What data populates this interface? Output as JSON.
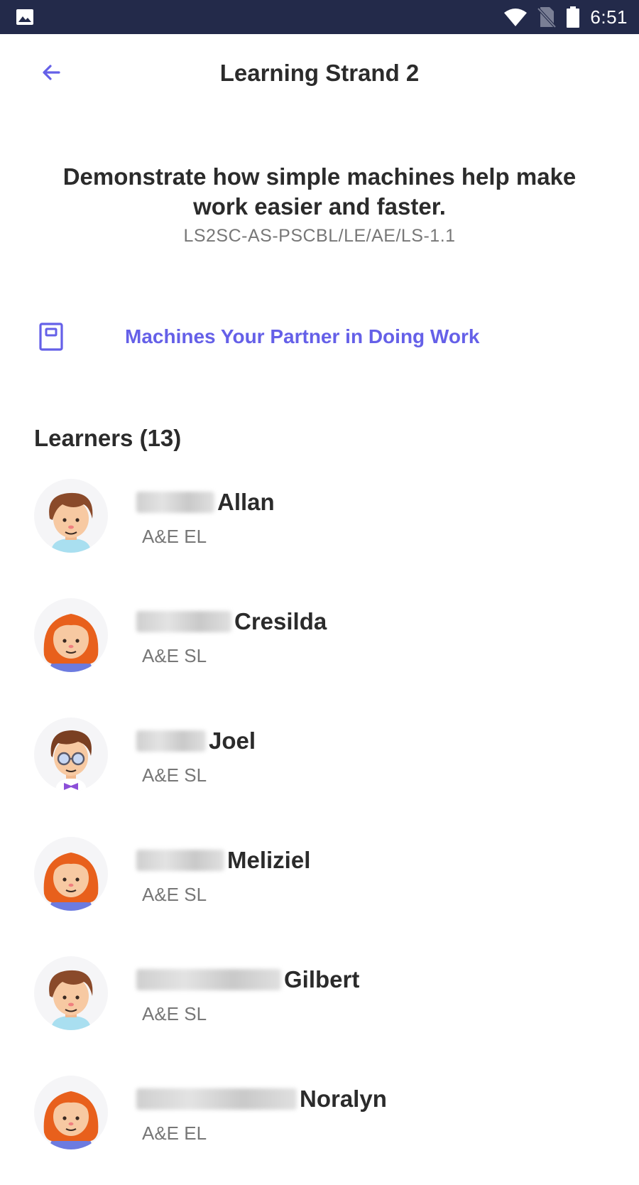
{
  "status_bar": {
    "time": "6:51",
    "icons": [
      "image-icon",
      "wifi-icon",
      "no-sim-icon",
      "battery-icon"
    ]
  },
  "header": {
    "back_icon": "arrow-left-icon",
    "title": "Learning Strand 2"
  },
  "objective": {
    "text": "Demonstrate how simple machines help make work easier and faster.",
    "code": "LS2SC-AS-PSCBL/LE/AE/LS-1.1"
  },
  "module": {
    "icon": "book-icon",
    "title": "Machines Your Partner in Doing Work"
  },
  "learners": {
    "header": "Learners (13)",
    "items": [
      {
        "name": "Allan",
        "type": "A&E EL",
        "avatar": "boy"
      },
      {
        "name": "Cresilda",
        "type": "A&E SL",
        "avatar": "girl"
      },
      {
        "name": "Joel",
        "type": "A&E SL",
        "avatar": "boy-glasses"
      },
      {
        "name": "Meliziel",
        "type": "A&E SL",
        "avatar": "girl"
      },
      {
        "name": "Gilbert",
        "type": "A&E SL",
        "avatar": "boy"
      },
      {
        "name": "Noralyn",
        "type": "A&E EL",
        "avatar": "girl"
      }
    ]
  },
  "colors": {
    "accent": "#6560e8",
    "status_bar": "#232a4a",
    "text_primary": "#2b2b2b",
    "text_secondary": "#777777"
  }
}
